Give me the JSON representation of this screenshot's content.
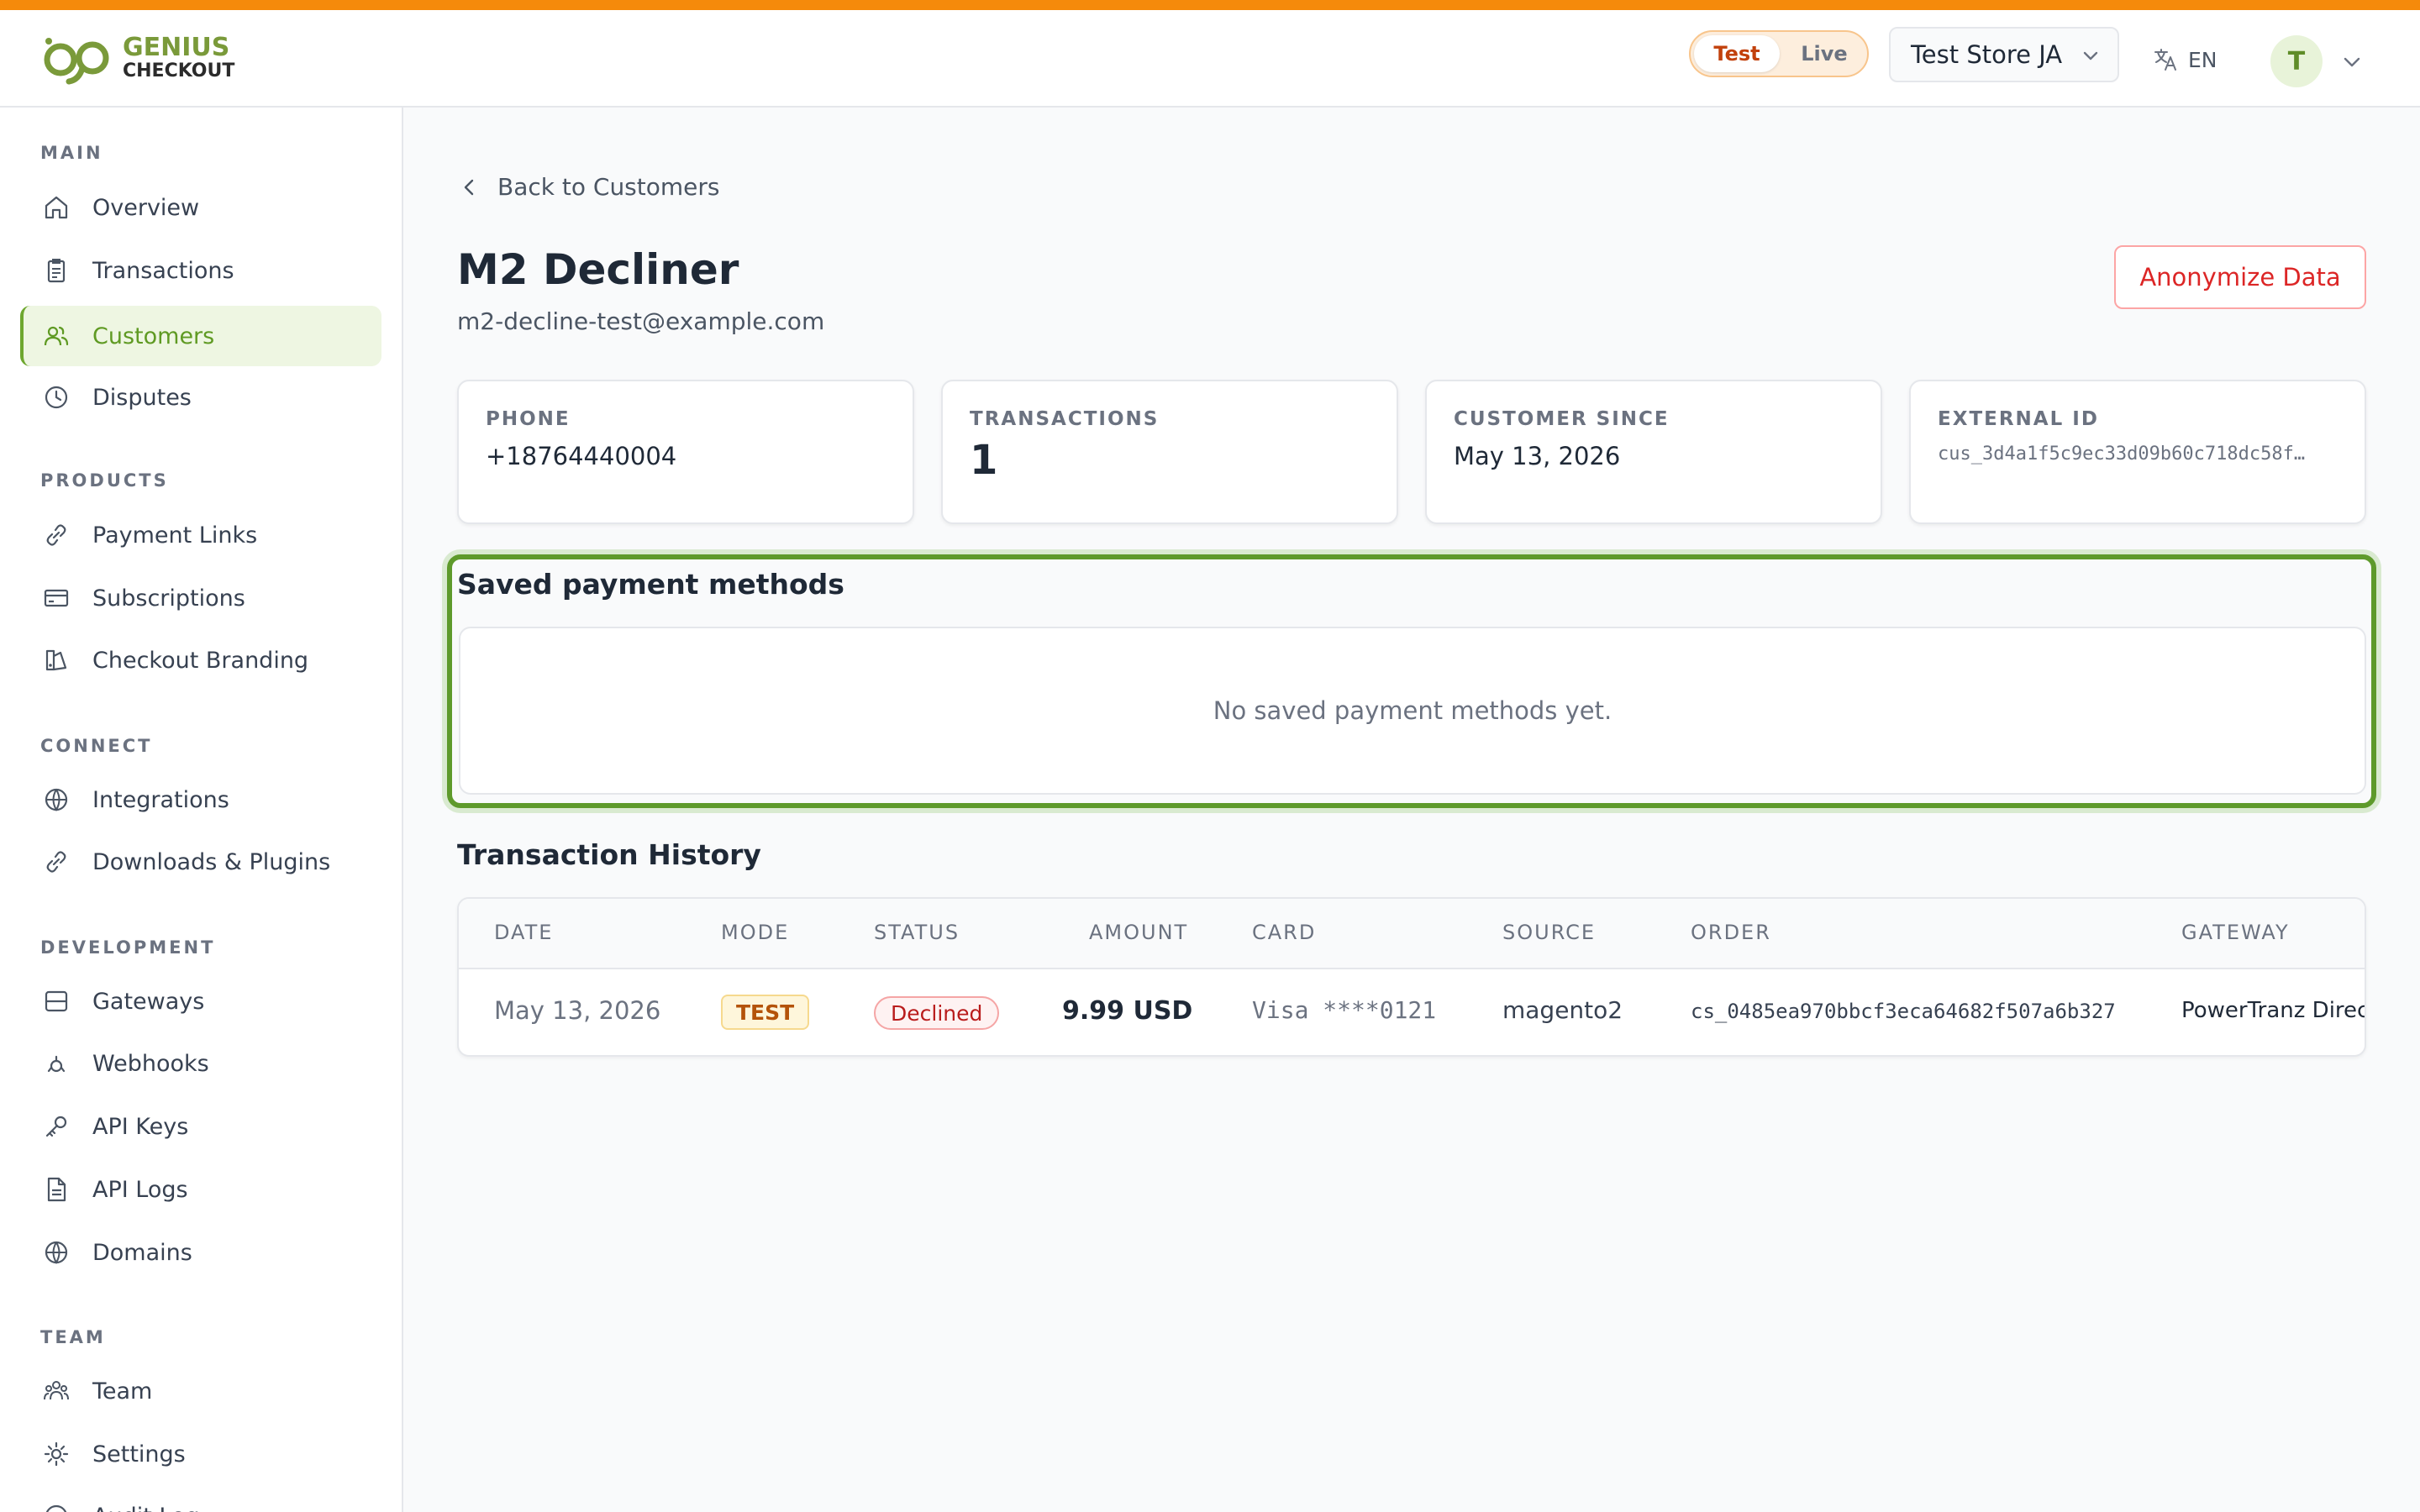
{
  "brand": {
    "line1": "GENIUS",
    "line2": "CHECKOUT"
  },
  "header": {
    "mode_test": "Test",
    "mode_live": "Live",
    "store": "Test Store JA",
    "language": "EN",
    "avatar_initial": "T"
  },
  "sidebar": {
    "sections": {
      "main": "MAIN",
      "products": "PRODUCTS",
      "connect": "CONNECT",
      "development": "DEVELOPMENT",
      "team": "TEAM"
    },
    "items": {
      "overview": "Overview",
      "transactions": "Transactions",
      "customers": "Customers",
      "disputes": "Disputes",
      "payment_links": "Payment Links",
      "subscriptions": "Subscriptions",
      "checkout_branding": "Checkout Branding",
      "integrations": "Integrations",
      "downloads_plugins": "Downloads & Plugins",
      "gateways": "Gateways",
      "webhooks": "Webhooks",
      "api_keys": "API Keys",
      "api_logs": "API Logs",
      "domains": "Domains",
      "team": "Team",
      "settings": "Settings",
      "audit": "Audit Log"
    }
  },
  "customer": {
    "back_label": "Back to Customers",
    "name": "M2 Decliner",
    "email": "m2-decline-test@example.com",
    "anonymize_label": "Anonymize Data"
  },
  "stats": {
    "phone_label": "PHONE",
    "phone": "+18764440004",
    "transactions_label": "TRANSACTIONS",
    "transactions": "1",
    "since_label": "CUSTOMER SINCE",
    "since": "May 13, 2026",
    "external_label": "EXTERNAL ID",
    "external": "cus_3d4a1f5c9ec33d09b60c718dc58f…"
  },
  "saved_methods": {
    "title": "Saved payment methods",
    "empty": "No saved payment methods yet."
  },
  "history": {
    "title": "Transaction History",
    "columns": {
      "date": "DATE",
      "mode": "MODE",
      "status": "STATUS",
      "amount": "AMOUNT",
      "card": "CARD",
      "source": "SOURCE",
      "order": "ORDER",
      "gateway": "GATEWAY"
    },
    "rows": [
      {
        "date": "May 13, 2026",
        "mode": "TEST",
        "status": "Declined",
        "amount": "9.99 USD",
        "card": "Visa ****0121",
        "source": "magento2",
        "order": "cs_0485ea970bbcf3eca64682f507a6b327",
        "gateway": "PowerTranz Direct"
      }
    ]
  },
  "colors": {
    "accent": "#6ea72f",
    "stripe": "#f58a0b",
    "danger": "#dc2626"
  }
}
